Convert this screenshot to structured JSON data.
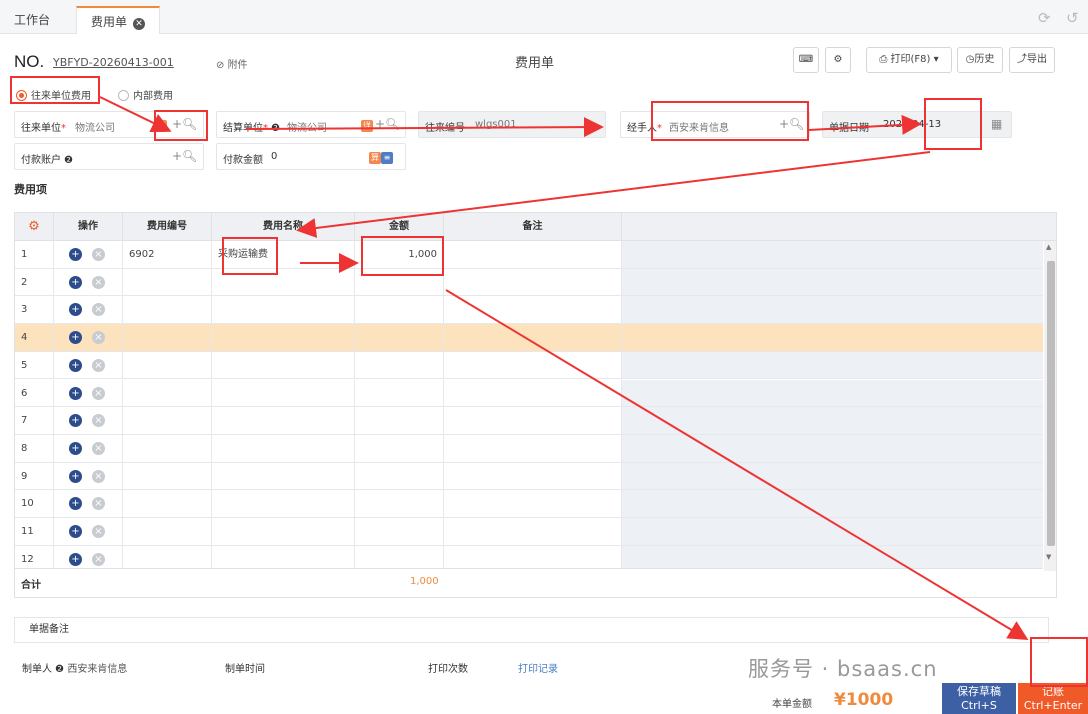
{
  "tabs": [
    {
      "label": "工作台"
    },
    {
      "label": "费用单",
      "close": "✖"
    }
  ],
  "header": {
    "no_label": "NO.",
    "no_value": "YBFYD-20260413-001",
    "attach": "附件",
    "title": "费用单",
    "print": "打印(F8)",
    "history": "历史",
    "export": "导出"
  },
  "radios": {
    "external": "往来单位费用",
    "internal": "内部费用"
  },
  "fields": {
    "partner_label": "往来单位",
    "partner_value": "物流公司",
    "settle_label": "结算单位",
    "settle_value": "物流公司",
    "contact_label": "往来编号",
    "contact_value": "wlgs001",
    "handler_label": "经手人",
    "handler_value": "西安来肯信息",
    "date_label": "单据日期",
    "date_value": "2026-04-13",
    "account_label": "付款账户",
    "amount_label": "付款金额",
    "amount_value": "0"
  },
  "section_title": "费用项",
  "grid": {
    "headers": [
      "操作",
      "费用编号",
      "费用名称",
      "金额",
      "备注"
    ],
    "rows": [
      {
        "no": "1",
        "code": "6902",
        "name": "采购运输费",
        "amount": "1,000"
      },
      {
        "no": "2",
        "code": "",
        "name": "",
        "amount": ""
      },
      {
        "no": "3",
        "code": "",
        "name": "",
        "amount": ""
      },
      {
        "no": "4",
        "code": "",
        "name": "",
        "amount": ""
      },
      {
        "no": "5",
        "code": "",
        "name": "",
        "amount": ""
      },
      {
        "no": "6",
        "code": "",
        "name": "",
        "amount": ""
      },
      {
        "no": "7",
        "code": "",
        "name": "",
        "amount": ""
      },
      {
        "no": "8",
        "code": "",
        "name": "",
        "amount": ""
      },
      {
        "no": "9",
        "code": "",
        "name": "",
        "amount": ""
      },
      {
        "no": "10",
        "code": "",
        "name": "",
        "amount": ""
      },
      {
        "no": "11",
        "code": "",
        "name": "",
        "amount": ""
      },
      {
        "no": "12",
        "code": "",
        "name": "",
        "amount": ""
      }
    ],
    "sum_label": "合计",
    "sum_value": "1,000"
  },
  "footer": {
    "remark": "单据备注",
    "creator_label": "制单人",
    "creator_value": "西安来肯信息",
    "time_label": "制单时间",
    "print_count_label": "打印次数",
    "print_log": "打印记录",
    "total_label": "本单金额",
    "total_value": "¥1000",
    "save_label": "保存草稿",
    "save_hint": "Ctrl+S",
    "post_label": "记账",
    "post_hint": "Ctrl+Enter"
  },
  "watermark": "服务号 · bsaas.cn",
  "colors": {
    "accent": "#f08a3c",
    "primary": "#3d5fa3",
    "danger": "#f05a28",
    "highlight_row": "#fde3bd"
  }
}
